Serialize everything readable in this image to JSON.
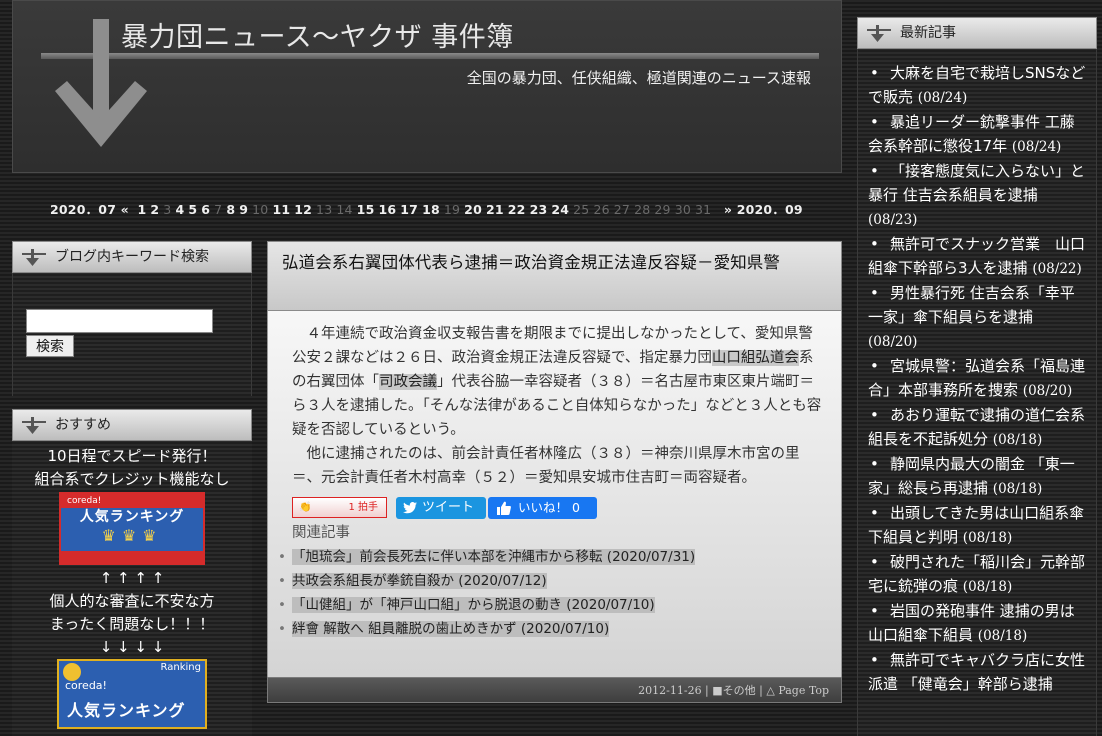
{
  "header": {
    "title": "暴力団ニュース〜ヤクザ 事件簿",
    "description": "全国の暴力団、任侠組織、極道関連のニュース速報"
  },
  "calendar": {
    "prev": "2020．07 «",
    "next": "» 2020．09",
    "days": [
      {
        "d": "1",
        "on": true
      },
      {
        "d": "2",
        "on": true
      },
      {
        "d": "3",
        "on": false
      },
      {
        "d": "4",
        "on": true
      },
      {
        "d": "5",
        "on": true
      },
      {
        "d": "6",
        "on": true
      },
      {
        "d": "7",
        "on": false
      },
      {
        "d": "8",
        "on": true
      },
      {
        "d": "9",
        "on": true
      },
      {
        "d": "10",
        "on": false
      },
      {
        "d": "11",
        "on": true
      },
      {
        "d": "12",
        "on": true
      },
      {
        "d": "13",
        "on": false
      },
      {
        "d": "14",
        "on": false
      },
      {
        "d": "15",
        "on": true
      },
      {
        "d": "16",
        "on": true
      },
      {
        "d": "17",
        "on": true
      },
      {
        "d": "18",
        "on": true
      },
      {
        "d": "19",
        "on": false
      },
      {
        "d": "20",
        "on": true
      },
      {
        "d": "21",
        "on": true
      },
      {
        "d": "22",
        "on": true
      },
      {
        "d": "23",
        "on": true
      },
      {
        "d": "24",
        "on": true
      },
      {
        "d": "25",
        "on": false
      },
      {
        "d": "26",
        "on": false
      },
      {
        "d": "27",
        "on": false
      },
      {
        "d": "28",
        "on": false
      },
      {
        "d": "29",
        "on": false
      },
      {
        "d": "30",
        "on": false
      },
      {
        "d": "31",
        "on": false
      }
    ]
  },
  "search": {
    "title": "ブログ内キーワード検索",
    "input_value": "",
    "button_label": "検索"
  },
  "recommend": {
    "title": "おすすめ",
    "line1": "10日程でスピード発行！",
    "line2": "組合系でクレジット機能なし",
    "banner1_top": "coreda!",
    "banner1_main": "人気ランキング",
    "banner1_crowns": "♛♛♛",
    "arrows_up": "↑ ↑ ↑ ↑",
    "line3": "個人的な審査に不安な方",
    "line4": "まったく問題なし！！！",
    "arrows_down": "↓ ↓ ↓ ↓",
    "banner2_rank": "Ranking",
    "banner2_brand": "coreda!",
    "banner2_main": "人気ランキング"
  },
  "entry": {
    "title": "弘道会系右翼団体代表ら逮捕＝政治資金規正法違反容疑－愛知県警",
    "para1_a": "４年連続で政治資金収支報告書を期限までに提出しなかったとして、愛知県警公安２課などは２６日、政治資金規正法違反容疑で、指定暴力団",
    "para1_hl1": "山口組弘道会",
    "para1_b": "系の右翼団体「",
    "para1_hl2": "司政会議",
    "para1_c": "」代表谷脇一幸容疑者（３８）＝名古屋市東区東片端町＝ら３人を逮捕した。「そんな法律があること自体知らなかった」などと３人とも容疑を否認しているという。",
    "para2": "他に逮捕されたのは、前会計責任者林隆広（３８）＝神奈川県厚木市宮の里＝、元会計責任者木村高幸（５２）＝愛知県安城市住吉町＝両容疑者。",
    "hakushu_label": "拍手",
    "hakushu_count": "1",
    "tweet_label": "ツイート",
    "like_label": "いいね！ 0",
    "related_heading": "関連記事",
    "related": [
      {
        "title": "「旭琉会」前会長死去に伴い本部を沖縄市から移転",
        "date": "(2020/07/31)"
      },
      {
        "title": "共政会系組長が拳銃自殺か",
        "date": "(2020/07/12)"
      },
      {
        "title": "「山健組」が「神戸山口組」から脱退の動き",
        "date": "(2020/07/10)"
      },
      {
        "title": "絆會 解散へ 組員離脱の歯止めきかず",
        "date": "(2020/07/10)"
      }
    ],
    "foot_date": "2012-11-26",
    "foot_category": "■その他",
    "foot_pagetop": "△ Page Top"
  },
  "recent": {
    "title": "最新記事",
    "items": [
      {
        "title": "大麻を自宅で栽培しSNSなどで販売",
        "date": "(08/24)"
      },
      {
        "title": "暴追リーダー銃撃事件 工藤会系幹部に懲役17年",
        "date": "(08/24)"
      },
      {
        "title": "「接客態度気に入らない」と暴行 住吉会系組員を逮捕",
        "date": "(08/23)"
      },
      {
        "title": "無許可でスナック営業　山口組傘下幹部ら3人を逮捕",
        "date": "(08/22)"
      },
      {
        "title": "男性暴行死 住吉会系「幸平一家」傘下組員らを逮捕",
        "date": "(08/20)"
      },
      {
        "title": "宮城県警：弘道会系「福島連合」本部事務所を捜索",
        "date": "(08/20)"
      },
      {
        "title": "あおり運転で逮捕の道仁会系組長を不起訴処分",
        "date": "(08/18)"
      },
      {
        "title": "静岡県内最大の闇金 「東一家」総長ら再逮捕",
        "date": "(08/18)"
      },
      {
        "title": "出頭してきた男は山口組系傘下組員と判明",
        "date": "(08/18)"
      },
      {
        "title": "破門された「稲川会」元幹部宅に銃弾の痕",
        "date": "(08/18)"
      },
      {
        "title": "岩国の発砲事件 逮捕の男は山口組傘下組員",
        "date": "(08/18)"
      },
      {
        "title": "無許可でキャバクラ店に女性派遣 「健竜会」幹部ら逮捕",
        "date": ""
      }
    ]
  }
}
